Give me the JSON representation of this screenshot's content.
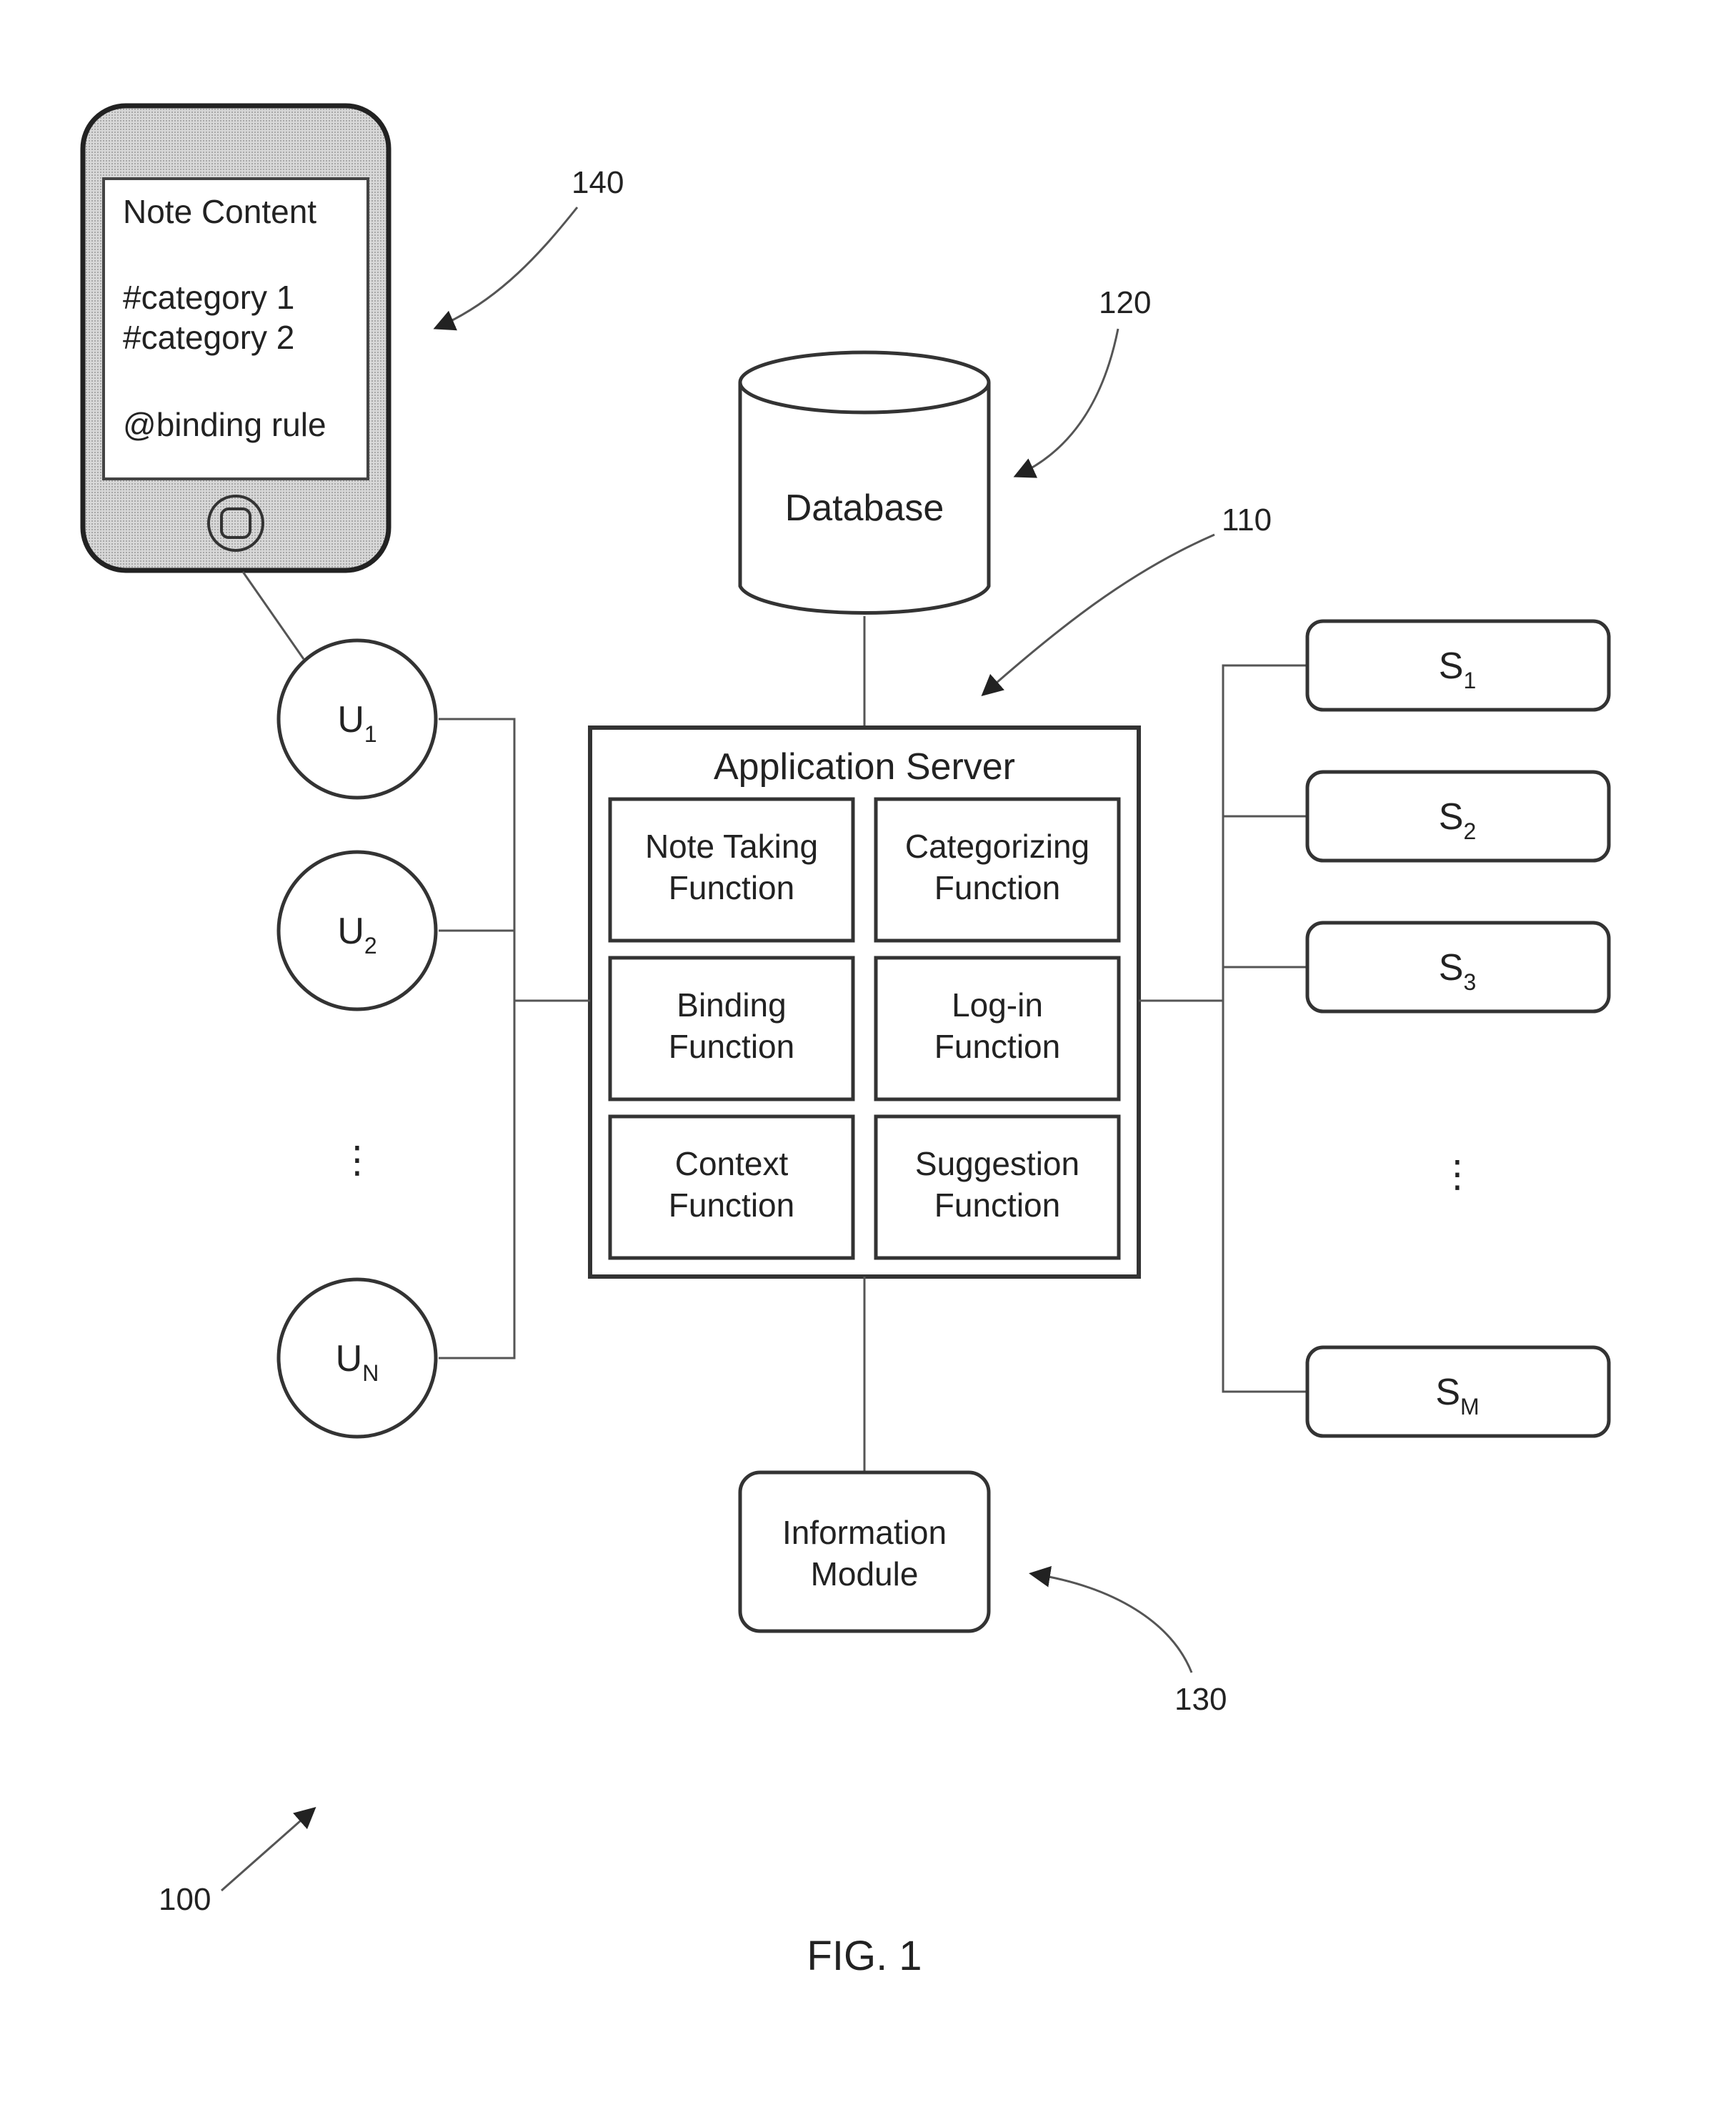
{
  "figure": {
    "caption": "FIG. 1",
    "system_ref": "100"
  },
  "device": {
    "ref": "140",
    "screen_lines": [
      "Note Content",
      "",
      "#category 1",
      "#category 2",
      "",
      "@binding rule"
    ]
  },
  "database": {
    "label": "Database",
    "ref": "120"
  },
  "app_server": {
    "title": "Application Server",
    "ref": "110",
    "functions": [
      [
        "Note Taking",
        "Function"
      ],
      [
        "Categorizing",
        "Function"
      ],
      [
        "Binding",
        "Function"
      ],
      [
        "Log-in",
        "Function"
      ],
      [
        "Context",
        "Function"
      ],
      [
        "Suggestion",
        "Function"
      ]
    ]
  },
  "info_module": {
    "lines": [
      "Information",
      "Module"
    ],
    "ref": "130"
  },
  "users": [
    {
      "base": "U",
      "sub": "1"
    },
    {
      "base": "U",
      "sub": "2"
    },
    {
      "base": "U",
      "sub": "N"
    }
  ],
  "users_ellipsis": "⋮",
  "services": [
    {
      "base": "S",
      "sub": "1"
    },
    {
      "base": "S",
      "sub": "2"
    },
    {
      "base": "S",
      "sub": "3"
    },
    {
      "base": "S",
      "sub": "M"
    }
  ],
  "services_ellipsis": "⋮"
}
